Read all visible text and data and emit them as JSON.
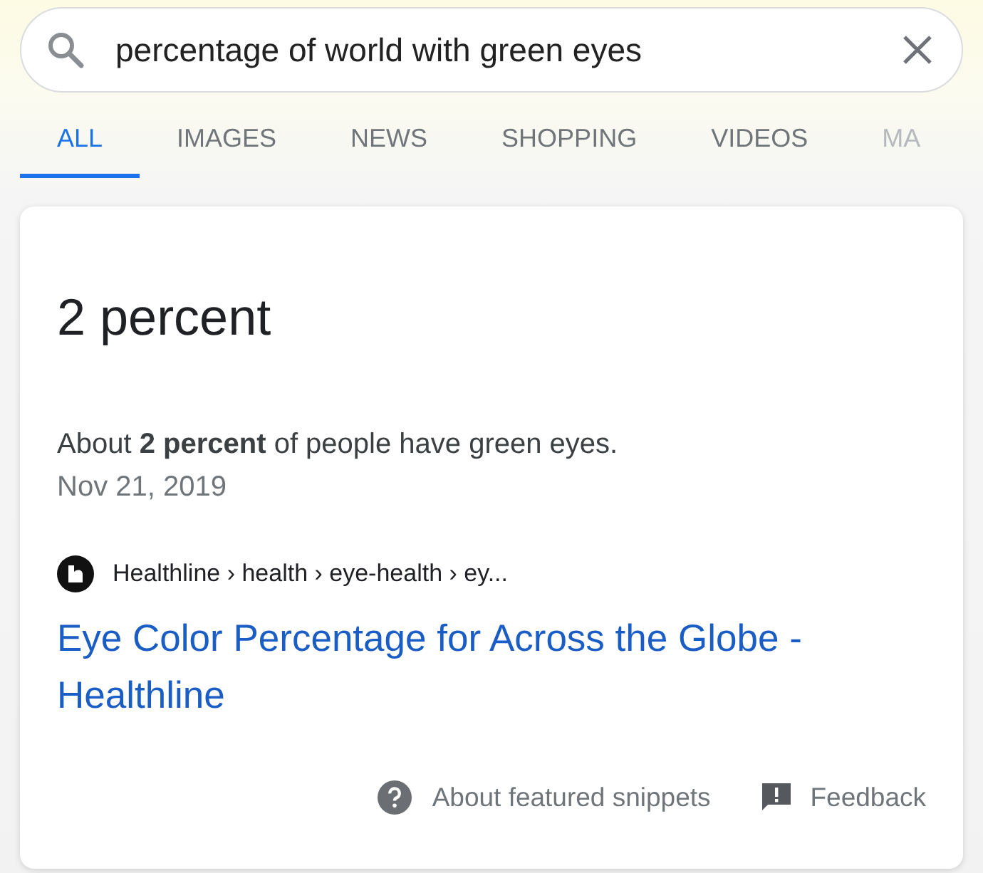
{
  "search": {
    "value": "percentage of world with green eyes"
  },
  "tabs": [
    {
      "label": "ALL",
      "selected": true
    },
    {
      "label": "IMAGES",
      "selected": false
    },
    {
      "label": "NEWS",
      "selected": false
    },
    {
      "label": "SHOPPING",
      "selected": false
    },
    {
      "label": "VIDEOS",
      "selected": false
    },
    {
      "label": "MA",
      "selected": false
    }
  ],
  "snippet": {
    "answer": "2 percent",
    "text": "About **2 percent** of people have green eyes.",
    "date": "Nov 21, 2019",
    "source": "Healthline › health › eye-health › ey...",
    "title": "Eye Color Percentage for Across the Globe - Healthline",
    "footer": {
      "about": "About featured snippets",
      "feedback": "Feedback"
    }
  }
}
